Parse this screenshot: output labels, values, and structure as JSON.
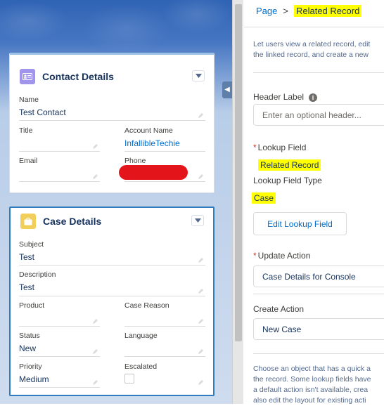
{
  "breadcrumb": {
    "parent": "Page",
    "separator": ">",
    "current": "Related Record"
  },
  "panel": {
    "description": [
      "Let users view a related record, edit",
      "the linked record, and create a new"
    ],
    "header_label": {
      "label": "Header Label",
      "info": "i",
      "placeholder": "Enter an optional header..."
    },
    "lookup_field": {
      "required": "*",
      "label": "Lookup Field",
      "value": "Related Record"
    },
    "lookup_field_type": {
      "label": "Lookup Field Type",
      "value": "Case"
    },
    "edit_lookup_button": "Edit Lookup Field",
    "update_action": {
      "required": "*",
      "label": "Update Action",
      "value": "Case Details for Console"
    },
    "create_action": {
      "label": "Create Action",
      "value": "New Case"
    },
    "help_text": [
      "Choose an object that has a quick a",
      "the record. Some lookup fields have",
      "a default action isn't available, crea",
      "also edit the layout for existing acti"
    ]
  },
  "contact_card": {
    "title": "Contact Details",
    "fields": {
      "name": {
        "label": "Name",
        "value": "Test Contact"
      },
      "title": {
        "label": "Title",
        "value": ""
      },
      "account_name": {
        "label": "Account Name",
        "value": "InfallibleTechie"
      },
      "email": {
        "label": "Email",
        "value": ""
      },
      "phone": {
        "label": "Phone",
        "value": ""
      }
    }
  },
  "case_card": {
    "title": "Case Details",
    "fields": {
      "subject": {
        "label": "Subject",
        "value": "Test"
      },
      "description": {
        "label": "Description",
        "value": "Test"
      },
      "product": {
        "label": "Product",
        "value": ""
      },
      "case_reason": {
        "label": "Case Reason",
        "value": ""
      },
      "status": {
        "label": "Status",
        "value": "New"
      },
      "language": {
        "label": "Language",
        "value": ""
      },
      "priority": {
        "label": "Priority",
        "value": "Medium"
      },
      "escalated": {
        "label": "Escalated",
        "checked": false
      }
    }
  },
  "colors": {
    "highlight": "#ffff00",
    "link": "#006dcc",
    "redaction": "#e4141b",
    "selected_border": "#2f7bbf"
  }
}
